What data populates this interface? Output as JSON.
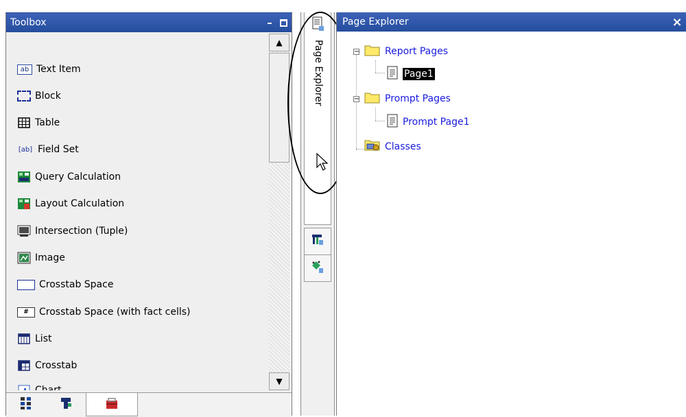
{
  "toolbox": {
    "title": "Toolbox",
    "minimize_glyph": "–",
    "items": [
      {
        "label": "Text Item",
        "icon": "text-item-icon"
      },
      {
        "label": "Block",
        "icon": "block-icon"
      },
      {
        "label": "Table",
        "icon": "table-icon"
      },
      {
        "label": "Field Set",
        "icon": "field-set-icon"
      },
      {
        "label": "Query Calculation",
        "icon": "query-calculation-icon"
      },
      {
        "label": "Layout Calculation",
        "icon": "layout-calculation-icon"
      },
      {
        "label": "Intersection (Tuple)",
        "icon": "intersection-tuple-icon"
      },
      {
        "label": "Image",
        "icon": "image-icon"
      },
      {
        "label": "Crosstab Space",
        "icon": "crosstab-space-icon"
      },
      {
        "label": "Crosstab Space (with fact cells)",
        "icon": "crosstab-space-fact-icon"
      },
      {
        "label": "List",
        "icon": "list-icon"
      },
      {
        "label": "Crosstab",
        "icon": "crosstab-icon"
      },
      {
        "label": "Chart",
        "icon": "chart-icon"
      }
    ],
    "bottom_tabs": [
      "source-tree-icon",
      "data-items-icon",
      "toolbox-icon"
    ]
  },
  "strip": {
    "label": "Page Explorer",
    "buttons": [
      "query-explorer-icon",
      "condition-explorer-icon"
    ]
  },
  "explorer": {
    "title": "Page Explorer",
    "close_glyph": "×",
    "report_pages": "Report Pages",
    "page1": "Page1",
    "prompt_pages": "Prompt Pages",
    "prompt_page1": "Prompt Page1",
    "classes": "Classes"
  }
}
